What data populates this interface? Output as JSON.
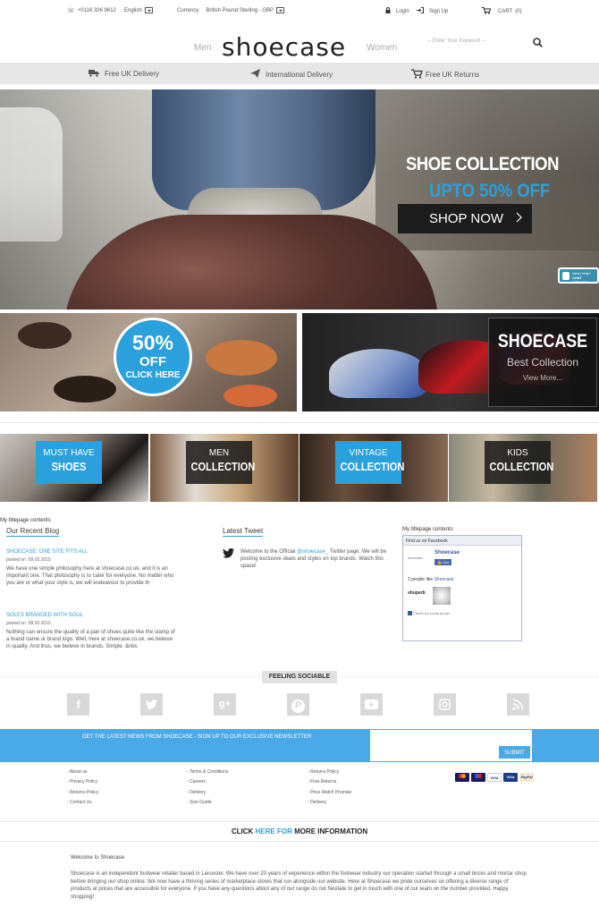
{
  "topbar": {
    "phone": "+0116 326 9612",
    "language": "English",
    "currency_label": "Currency",
    "currency_value": "British Pound Sterling - GBP",
    "login": "Login",
    "signup": "Sign Up",
    "cart": "CART",
    "cart_count": "(0)"
  },
  "header": {
    "logo": "shoecase",
    "men": "Men",
    "women": "Women",
    "search_placeholder": "-- Enter Your Keyword --"
  },
  "strip": {
    "uk_delivery": "Free UK Delivery",
    "intl_delivery": "International Delivery",
    "uk_returns": "Free UK Returns"
  },
  "hero": {
    "title": "SHOE COLLECTION",
    "subtitle": "UPTO 50% OFF",
    "button": "SHOP NOW",
    "chat_line1": "Need Help?",
    "chat_line2": "CHAT OFFLINE"
  },
  "promo_left": {
    "percent": "50%",
    "off": "OFF",
    "click": "CLICK HERE"
  },
  "promo_right": {
    "title": "SHOECASE",
    "subtitle": "Best Collection",
    "link": "View More..."
  },
  "categories": [
    {
      "line1": "MUST HAVE",
      "line2": "SHOES"
    },
    {
      "line1": "MEN",
      "line2": "COLLECTION"
    },
    {
      "line1": "VINTAGE",
      "line2": "COLLECTION"
    },
    {
      "line1": "KIDS",
      "line2": "COLLECTION"
    }
  ],
  "content": {
    "titlepage_left": "My titlepage contents",
    "titlepage_right": "My titlepage contents",
    "blog_title": "Our Recent Blog",
    "tweet_title": "Latest Tweet",
    "posts": [
      {
        "title": "SHOECASE: ONE SITE FITS ALL",
        "date": "posted on :09.02.2015",
        "body": "We have one simple philosophy here at shoecase.co.uk, and it is an important one. That philosophy is to cater for everyone. No matter who you are or what your style is, we will endeavour to provide th"
      },
      {
        "title": "SOLES BRANDED WITH SOUL",
        "date": "posted on :09.02.2015",
        "body": "Nothing can ensure the quality of a pair of shoes quite like the stamp of a brand name or brand logo. Well, here at shoecase.co.uk, we believe in quality. And thus, we believe in brands. Simple. &nbs"
      }
    ],
    "tweet_pre": "Welcome to the Official ",
    "tweet_handle": "@shoecase_",
    "tweet_post": " Twitter page. We will be posting exclusive deals and styles on top brands. Watch this space!"
  },
  "facebook": {
    "header": "Find us on Facebook",
    "page_name": "Shoecase",
    "page_logo": "shoecase",
    "like": "Like",
    "people_pre": "2 people like ",
    "people_page": "Shoecase.",
    "friend": "shuperb",
    "plugin": "Facebook social plugin"
  },
  "social": {
    "title": "FEELING SOCIABLE",
    "icons": [
      "facebook-icon",
      "twitter-icon",
      "google-plus-icon",
      "pinterest-icon",
      "youtube-icon",
      "instagram-icon",
      "rss-icon"
    ]
  },
  "newsletter": {
    "text": "GET THE LATEST NEWS FROM SHOECASE - SIGN UP TO OUR EXCLUSIVE NEWSLETTER",
    "button": "SUBMIT"
  },
  "footer": {
    "col1": [
      "About us",
      "Privacy Policy",
      "Returns Policy",
      "Contact Us"
    ],
    "col2": [
      "Terms & Conditions",
      "Careers",
      "Delivery",
      "Size Guide"
    ],
    "col3": [
      "Returns Policy",
      "Free Returns",
      "Price Match Promise",
      "Delivery"
    ],
    "payment_cards": [
      "MasterCard",
      "Maestro",
      "VISA",
      "VISA Electron",
      "PayPal"
    ]
  },
  "more": {
    "pre": "CLICK ",
    "link": "HERE FOR",
    "post": " MORE INFORMATION"
  },
  "welcome": {
    "title": "Welcome to Shoecase",
    "text": "Shoecase is an independent footwear retailer based in Leicester. We have over 20 years of experience within the footwear industry our operation started through a small bricks and mortar shop before bringing our shop online. We now have a thriving series of marketplace stores that run alongside our website. Here at Shoecase we pride ourselves on offering a diverse range of products at prices that are accessible for everyone. If you have any questions about any of our range do not hesitate to get in touch with one of our team on the number provided. Happy shopping!"
  },
  "colors": {
    "accent": "#2aa0dc",
    "newsletter": "#4aaae8",
    "strip": "#e7e7e7"
  }
}
